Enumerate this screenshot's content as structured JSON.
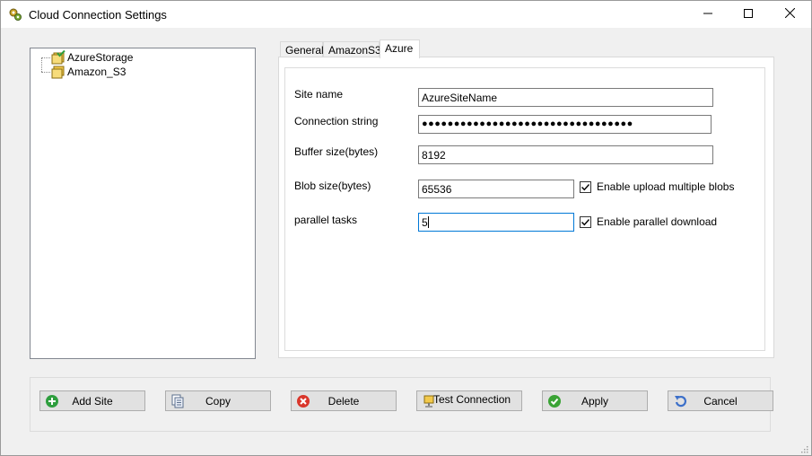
{
  "window": {
    "title": "Cloud Connection Settings",
    "icon": "gears-icon",
    "controls": [
      "minimize-icon",
      "maximize-icon",
      "close-icon"
    ]
  },
  "tree": {
    "items": [
      {
        "label": "AzureStorage",
        "icon": "storage-check-icon"
      },
      {
        "label": "Amazon_S3",
        "icon": "storage-icon"
      }
    ]
  },
  "tabs": [
    {
      "label": "General"
    },
    {
      "label": "AmazonS3"
    },
    {
      "label": "Azure",
      "active": true
    }
  ],
  "form": {
    "site_name": {
      "label": "Site name",
      "value": "AzureSiteName"
    },
    "connection_string": {
      "label": "Connection string",
      "value": "●●●●●●●●●●●●●●●●●●●●●●●●●●●●●●●●●"
    },
    "buffer_size": {
      "label": "Buffer size(bytes)",
      "value": "8192"
    },
    "blob_size": {
      "label": "Blob size(bytes)",
      "value": "65536"
    },
    "parallel_tasks": {
      "label": "parallel tasks",
      "value": "5"
    },
    "enable_upload_multiple_blobs": {
      "label": "Enable upload multiple blobs",
      "checked": true
    },
    "enable_parallel_download": {
      "label": "Enable parallel download",
      "checked": true
    }
  },
  "buttons": {
    "add_site": {
      "label": "Add Site",
      "icon": "add-icon"
    },
    "copy": {
      "label": "Copy",
      "icon": "copy-icon"
    },
    "delete": {
      "label": "Delete",
      "icon": "delete-icon"
    },
    "test_connection": {
      "label": "Test Connection",
      "icon": "test-connection-icon"
    },
    "apply": {
      "label": "Apply",
      "icon": "apply-icon"
    },
    "cancel": {
      "label": "Cancel",
      "icon": "undo-icon"
    }
  },
  "colors": {
    "accent": "#0078d7",
    "add_green": "#2e9e3e",
    "delete_red": "#d9362b",
    "apply_green": "#3aa335",
    "cancel_blue": "#3b6fc9"
  }
}
